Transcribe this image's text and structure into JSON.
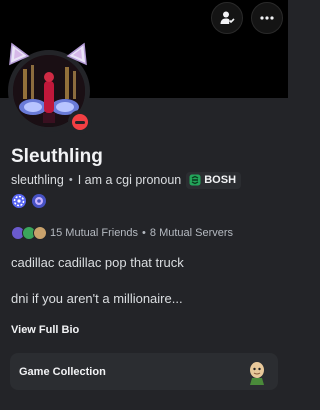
{
  "header": {
    "friend_button_icon": "add-friend-icon",
    "more_button_icon": "more-options-icon"
  },
  "profile": {
    "display_name": "Sleuthling",
    "username": "sleuthling",
    "separator": "•",
    "pronouns": "I am a cgi pronoun",
    "clan_tag": "BOSH",
    "status": "do-not-disturb",
    "status_color": "#f23f43",
    "badges": [
      "quest-badge-icon",
      "orbs-badge-icon"
    ]
  },
  "mutuals": {
    "friends": "15 Mutual Friends",
    "separator": "•",
    "servers": "8 Mutual Servers"
  },
  "bio": {
    "line1": "cadillac cadillac pop that truck",
    "line2": "dni if you aren't a millionaire...",
    "view_full_label": "View Full Bio"
  },
  "game_collection": {
    "label": "Game Collection",
    "icon": "game-character-icon"
  },
  "colors": {
    "background": "#232428",
    "banner": "#000000",
    "card": "#2b2d31",
    "text_primary": "#f2f3f5",
    "text_secondary": "#b5bac1"
  }
}
